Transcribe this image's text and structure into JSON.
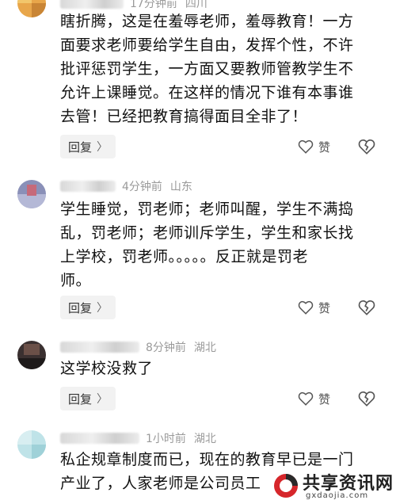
{
  "comments": [
    {
      "time": "17分钟前",
      "location": "四川",
      "lines": [
        "瞎折腾，这是在羞辱老师，羞辱教育！一方",
        "面要求老师要给学生自由，发挥个性，不许",
        "批评惩罚学生，一方面又要教师管教学生不",
        "允许上课睡觉。在这样的情况下谁有本事谁",
        "去管！已经把教育搞得面目全非了！"
      ],
      "reply_label": "回复",
      "like_label": "赞"
    },
    {
      "time": "4分钟前",
      "location": "山东",
      "lines": [
        "学生睡觉，罚老师；老师叫醒，学生不满捣",
        "乱，罚老师；老师训斥学生，学生和家长找",
        "上学校，罚老师。。。。。反正就是罚老",
        "师。"
      ],
      "reply_label": "回复",
      "like_label": "赞"
    },
    {
      "time": "8分钟前",
      "location": "湖北",
      "lines": [
        "这学校没救了"
      ],
      "reply_label": "回复",
      "like_label": "赞"
    },
    {
      "time": "1小时前",
      "location": "湖北",
      "lines": [
        "私企规章制度而已，现在的教育早已是一门",
        "产业了，人家老师是公司员工"
      ]
    }
  ],
  "icons": {
    "reply_chevron": "chevron-right-icon",
    "like": "heart-icon",
    "dislike": "broken-heart-icon"
  },
  "watermark": {
    "title": "共享资讯网",
    "url": "gxdaojia.com"
  },
  "colors": {
    "meta_text": "#9a9a9a",
    "body_text": "#111111",
    "reply_bg": "#f2f2f2",
    "watermark_red": "#d6262b"
  }
}
